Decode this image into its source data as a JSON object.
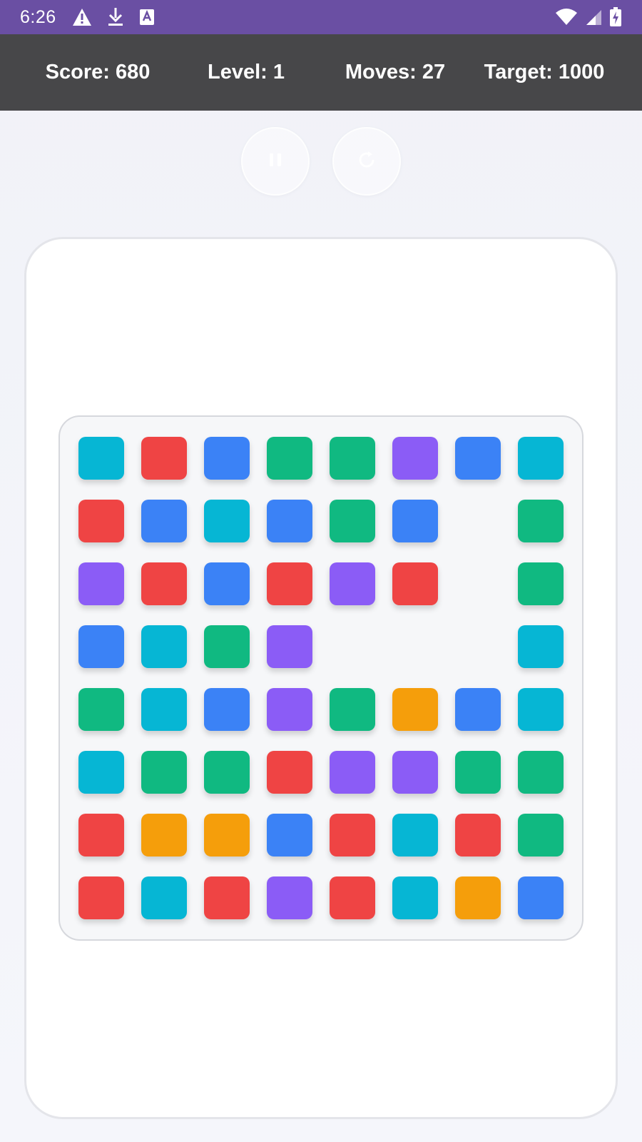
{
  "status_bar": {
    "time": "6:26",
    "icons": [
      "alert-icon",
      "download-icon",
      "text-app-icon",
      "wifi-icon",
      "signal-icon",
      "battery-charging-icon"
    ]
  },
  "header": {
    "score": "Score: 680",
    "level": "Level: 1",
    "moves": "Moves: 27",
    "target": "Target: 1000"
  },
  "controls": {
    "icons": [
      "pause-icon",
      "restart-icon"
    ]
  },
  "colors": {
    "status_bar": "#6a4fa3",
    "header": "#474749",
    "C": "#06b6d4",
    "R": "#ef4444",
    "B": "#3b82f6",
    "G": "#10b981",
    "P": "#8b5cf6",
    "O": "#f59e0b"
  },
  "board": {
    "size": 8,
    "rows": [
      [
        "C",
        "R",
        "B",
        "G",
        "G",
        "P",
        "B",
        "C"
      ],
      [
        "R",
        "B",
        "C",
        "B",
        "G",
        "B",
        "",
        "G"
      ],
      [
        "P",
        "R",
        "B",
        "R",
        "P",
        "R",
        "",
        "G"
      ],
      [
        "B",
        "C",
        "G",
        "P",
        "",
        "",
        "",
        "C"
      ],
      [
        "G",
        "C",
        "B",
        "P",
        "G",
        "O",
        "B",
        "C"
      ],
      [
        "C",
        "G",
        "G",
        "R",
        "P",
        "P",
        "G",
        "G"
      ],
      [
        "R",
        "O",
        "O",
        "B",
        "R",
        "C",
        "R",
        "G"
      ],
      [
        "R",
        "C",
        "R",
        "P",
        "R",
        "C",
        "O",
        "B"
      ]
    ]
  }
}
